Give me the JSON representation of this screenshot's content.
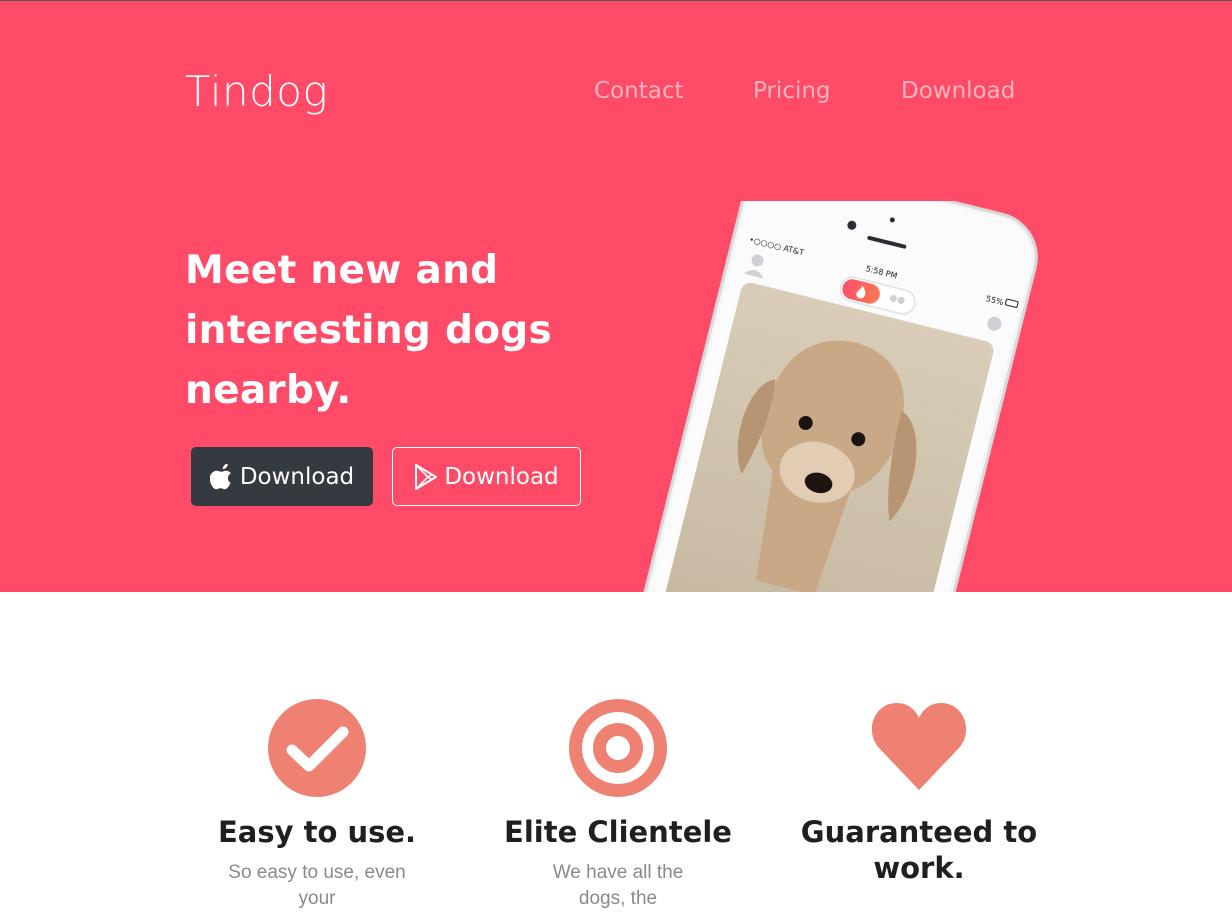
{
  "nav": {
    "brand": "Tindog",
    "links": [
      "Contact",
      "Pricing",
      "Download"
    ]
  },
  "hero": {
    "headline": "Meet new and interesting dogs nearby.",
    "buttons": [
      {
        "label": "Download",
        "icon": "apple-icon"
      },
      {
        "label": "Download",
        "icon": "google-play-icon"
      }
    ],
    "phone_status": {
      "carrier": "•○○○○ AT&T",
      "time": "5:58 PM",
      "battery": "55%"
    }
  },
  "features": [
    {
      "title": "Easy to use.",
      "text": "So easy to use, even your",
      "icon": "check-circle-icon"
    },
    {
      "title": "Elite Clientele",
      "text": "We have all the dogs, the",
      "icon": "bullseye-icon"
    },
    {
      "title": "Guaranteed to work.",
      "text": "",
      "icon": "heart-icon"
    }
  ],
  "colors": {
    "brand": "#ff4b67",
    "button_dark": "#343a40",
    "feature_icon": "#ef8172"
  }
}
